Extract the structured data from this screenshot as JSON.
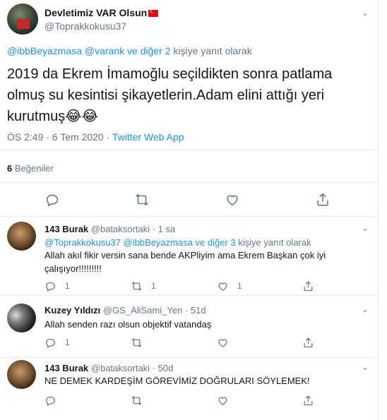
{
  "main_tweet": {
    "name": "Devletimiz VAR Olsun",
    "handle": "@Toprakkokusu37",
    "reply_prefix_handles": "@ibbBeyazmasa @varank ve diğer 2",
    "reply_suffix": "kişiye yanıt olarak",
    "text": "2019 da Ekrem İmamoğlu seçildikten sonra patlama olmuş su kesintisi şikayetlerin.Adam elini attığı yeri kurutmuş😂😂",
    "time": "ÖS 2:49 · 6 Tem 2020 ·",
    "source": "Twitter Web App",
    "likes_count": "6",
    "likes_label": "Beğeniler"
  },
  "replies": [
    {
      "name": "143 Burak",
      "handle": "@bataksortaki",
      "time": "· 1 sa",
      "reply_to_handles": "@Toprakkokusu37 @ibbBeyazmasa ve diğer 3",
      "reply_to_suffix": "kişiye yanıt olarak",
      "text": "Allah akıl fikir versin sana bende AKPliyim ama Ekrem Başkan çok iyi çalışıyor!!!!!!!!!",
      "reply_count": "1",
      "retweet_count": "1",
      "like_count": "1"
    },
    {
      "name": "Kuzey Yıldızı",
      "handle": "@GS_AliSami_Yen",
      "time": "· 51d",
      "text": "Allah senden razı olsun objektif vatandaş",
      "reply_count": "1"
    },
    {
      "name": "143 Burak",
      "handle": "@bataksortaki",
      "time": "· 50d",
      "text": "NE DEMEK KARDEŞİM GÖREVİMİZ DOĞRULARI SÖYLEMEK!"
    }
  ],
  "icons": {
    "reply": "reply-icon",
    "retweet": "retweet-icon",
    "like": "like-icon",
    "share": "share-icon",
    "caret": "chevron-down-icon"
  },
  "colors": {
    "link": "#1b95e0",
    "muted": "#657786",
    "divider": "#e6ecf0"
  }
}
